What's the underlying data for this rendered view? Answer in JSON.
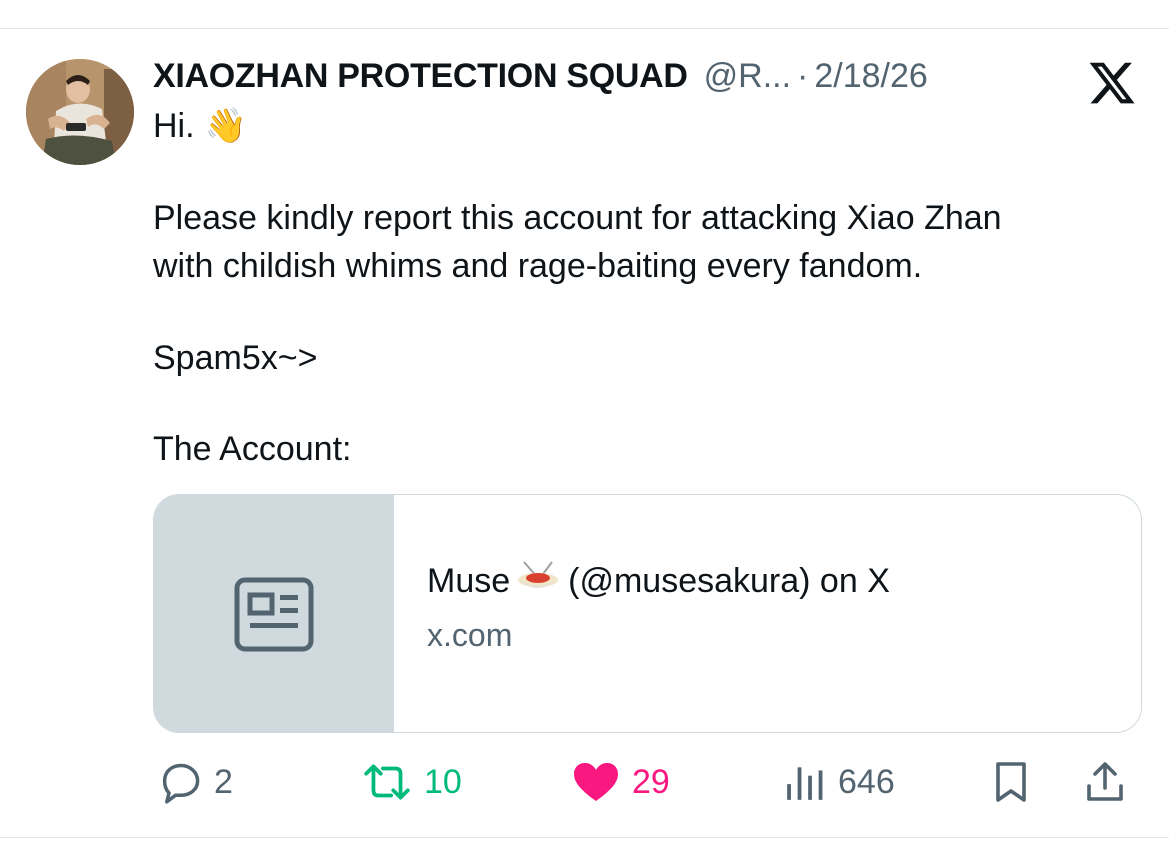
{
  "post": {
    "author": {
      "name": "XIAOZHAN PROTECTION SQUAD",
      "handle": "@R...",
      "avatar": "avatar"
    },
    "separator": "·",
    "date": "2/18/26",
    "platform_icon": "x-logo-icon",
    "text": {
      "line1": "Hi.",
      "line1_emoji": "👋",
      "line2": "Please kindly report this account for attacking Xiao Zhan",
      "line3": "with childish whims and rage-baiting every fandom.",
      "line4": "Spam5x~>",
      "line5": "The Account:"
    }
  },
  "link_card": {
    "thumbnail_icon": "article-icon",
    "title_before": "Muse",
    "title_emoji": "spaghetti-icon",
    "title_after": "(@musesakura) on X",
    "domain": "x.com"
  },
  "actions": {
    "replies": "2",
    "reposts": "10",
    "likes": "29",
    "views": "646",
    "icons": [
      "reply-icon",
      "retweet-icon",
      "heart-icon",
      "views-icon",
      "bookmark-icon",
      "share-icon"
    ]
  },
  "colors": {
    "text_primary": "#0f1419",
    "text_secondary": "#536471",
    "retweet_green": "#00ba7c",
    "like_pink": "#f91880",
    "card_border": "#cfd9de",
    "thumb_bg": "#cfd9de"
  }
}
